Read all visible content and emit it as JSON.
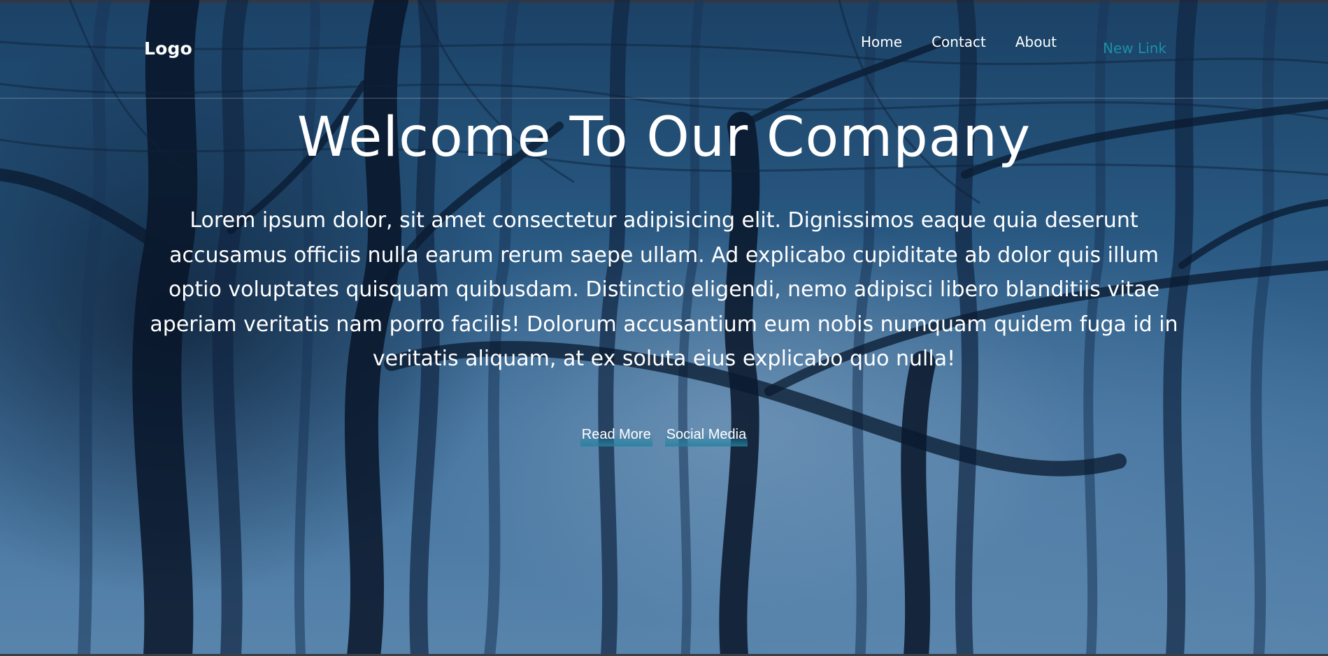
{
  "navbar": {
    "logo": "Logo",
    "links": [
      {
        "label": "Home"
      },
      {
        "label": "Contact"
      },
      {
        "label": "About"
      },
      {
        "label": "New Link"
      }
    ]
  },
  "hero": {
    "title": "Welcome To Our Company",
    "text": "Lorem ipsum dolor, sit amet consectetur adipisicing elit. Dignissimos eaque quia deserunt accusamus officiis nulla earum rerum saepe ullam. Ad explicabo cupiditate ab dolor quis illum optio voluptates quisquam quibusdam. Distinctio eligendi, nemo adipisci libero blanditiis vitae aperiam veritatis nam porro facilis! Dolorum accusantium eum nobis numquam quidem fuga id in veritatis aliquam, at ex soluta eius explicabo quo nulla!",
    "buttons": [
      {
        "label": "Read More"
      },
      {
        "label": "Social Media"
      }
    ]
  },
  "colors": {
    "accent": "#1d8fa6",
    "text": "#ffffff",
    "background": "#2f6591"
  }
}
